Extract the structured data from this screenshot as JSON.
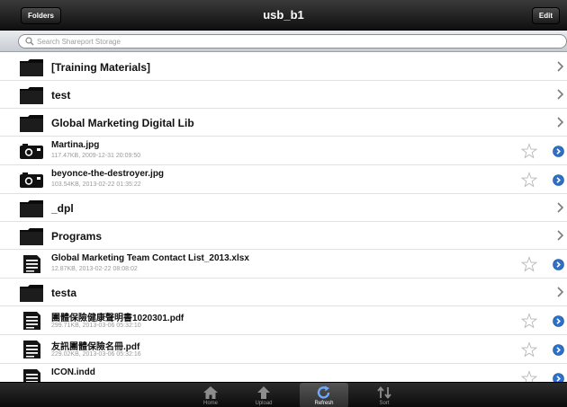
{
  "navbar": {
    "left_button": "Folders",
    "title": "usb_b1",
    "right_button": "Edit"
  },
  "search": {
    "placeholder": "Search Shareport Storage"
  },
  "items": [
    {
      "type": "folder",
      "name": "[Training Materials]"
    },
    {
      "type": "folder",
      "name": "test"
    },
    {
      "type": "folder",
      "name": "Global Marketing Digital Lib"
    },
    {
      "type": "file",
      "icon": "camera-icon",
      "name": "Martina.jpg",
      "meta": "117.47KB, 2009-12-31 20:09:50"
    },
    {
      "type": "file",
      "icon": "camera-icon",
      "name": "beyonce-the-destroyer.jpg",
      "meta": "103.54KB, 2013-02-22 01:35:22"
    },
    {
      "type": "folder",
      "name": "_dpl"
    },
    {
      "type": "folder",
      "name": "Programs"
    },
    {
      "type": "file",
      "icon": "document-icon",
      "name": "Global Marketing Team Contact List_2013.xlsx",
      "meta": "12.87KB, 2013-02-22 08:08:02"
    },
    {
      "type": "folder",
      "name": "testa"
    },
    {
      "type": "file",
      "icon": "document-icon",
      "name": "團體保險健康聲明書1020301.pdf",
      "meta": "299.71KB, 2013-03-06 05:32:10"
    },
    {
      "type": "file",
      "icon": "document-icon",
      "name": "友訊團體保險名冊.pdf",
      "meta": "229.02KB, 2013-03-06 05:32:16"
    },
    {
      "type": "file",
      "icon": "document-icon",
      "name": "ICON.indd",
      "meta": ""
    }
  ],
  "tabs": [
    {
      "id": "home",
      "label": "Home",
      "icon": "home-icon",
      "active": false
    },
    {
      "id": "upload",
      "label": "Upload",
      "icon": "upload-icon",
      "active": false
    },
    {
      "id": "refresh",
      "label": "Refresh",
      "icon": "refresh-icon",
      "active": true
    },
    {
      "id": "sort",
      "label": "Sort",
      "icon": "sort-icon",
      "active": false
    }
  ],
  "colors": {
    "navbar": "#1a1a1a",
    "accent": "#2f6fc7",
    "folder": "#111111"
  }
}
